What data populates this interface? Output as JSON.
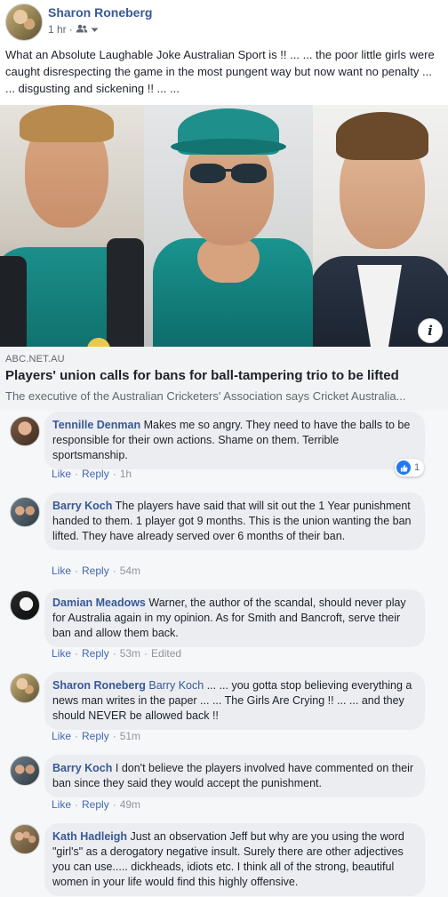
{
  "post": {
    "author": "Sharon Roneberg",
    "time": "1 hr",
    "separator": "·",
    "audience_icon": "friends-icon",
    "menu_icon": "chevron-down-icon",
    "text": "What an Absolute Laughable Joke Australian Sport is !! ... ... the poor little girls were caught disrespecting the game in the most pungent way but now want no penalty ... ... disgusting and sickening !! ... ..."
  },
  "link": {
    "domain": "ABC.NET.AU",
    "title": "Players' union calls for bans for ball-tampering trio to be lifted",
    "description": "The executive of the Australian Cricketers' Association says Cricket Australia..."
  },
  "actions": {
    "like": "Like",
    "reply": "Reply",
    "dot": "·"
  },
  "comments": [
    {
      "name": "Tennille Denman",
      "tag": "",
      "text": "Makes me so angry. They need to have the balls to be responsible for their own actions. Shame on them. Terrible sportsmanship.",
      "time": "1h",
      "edited": "",
      "reactions": "1"
    },
    {
      "name": "Barry Koch",
      "tag": "",
      "text": "The players have said that will sit out the 1 Year punishment handed to them. 1 player got 9 months. This is the union wanting the ban lifted. They have already served over 6 months of their ban.",
      "time": "54m",
      "edited": "",
      "reactions": ""
    },
    {
      "name": "Damian Meadows",
      "tag": "",
      "text": "Warner, the author of the scandal, should never play for Australia again in my opinion. As for Smith and Bancroft, serve their ban and allow them back.",
      "time": "53m",
      "edited": "Edited",
      "reactions": ""
    },
    {
      "name": "Sharon Roneberg",
      "tag": "Barry Koch",
      "text": "... ... you gotta stop believing everything a news man writes in the paper ... ... The Girls Are Crying !! ... ... and they should NEVER be allowed back !!",
      "time": "51m",
      "edited": "",
      "reactions": ""
    },
    {
      "name": "Barry Koch",
      "tag": "",
      "text": "I don't believe the players involved have commented on their ban since they said they would accept the punishment.",
      "time": "49m",
      "edited": "",
      "reactions": ""
    },
    {
      "name": "Kath Hadleigh",
      "tag": "",
      "text": "Just an observation Jeff but why are you using the word \"girl's\" as a derogatory negative insult. Surely there are other adjectives you can use..... dickheads, idiots etc. I think all of the strong, beautiful women in your life would find this highly offensive.",
      "time": "",
      "edited": "",
      "reactions": ""
    }
  ],
  "colors": {
    "name_link": "#385898",
    "action_link": "#4267b2",
    "bubble": "#ebedf0",
    "like_badge": "#2078f4"
  }
}
